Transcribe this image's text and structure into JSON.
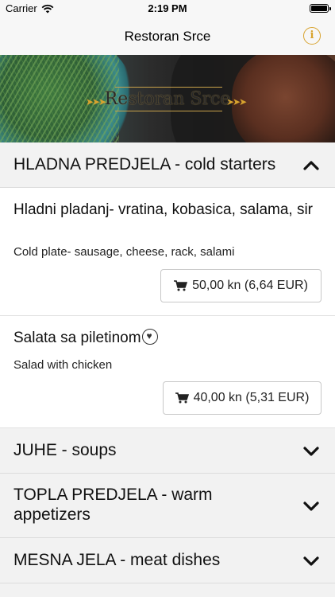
{
  "status_bar": {
    "carrier": "Carrier",
    "time": "2:19 PM"
  },
  "nav": {
    "title": "Restoran Srce",
    "info_icon": "info-icon"
  },
  "hero": {
    "logo_text": "Restoran Srce"
  },
  "sections": [
    {
      "title": "HLADNA PREDJELA - cold starters",
      "expanded": true
    },
    {
      "title": "JUHE - soups",
      "expanded": false
    },
    {
      "title": "TOPLA PREDJELA - warm appetizers",
      "expanded": false
    },
    {
      "title": "MESNA JELA - meat dishes",
      "expanded": false
    }
  ],
  "items": [
    {
      "name": "Hladni pladanj- vratina, kobasica, salama, sir",
      "description": "Cold plate- sausage, cheese, rack, salami",
      "price": "50,00 kn (6,64 EUR)"
    },
    {
      "name": "Salata sa piletinom",
      "description": "Salad with chicken",
      "price": "40,00 kn (5,31 EUR)"
    }
  ],
  "colors": {
    "accent": "#d8a32e",
    "header_bg": "#f2f2f2"
  }
}
